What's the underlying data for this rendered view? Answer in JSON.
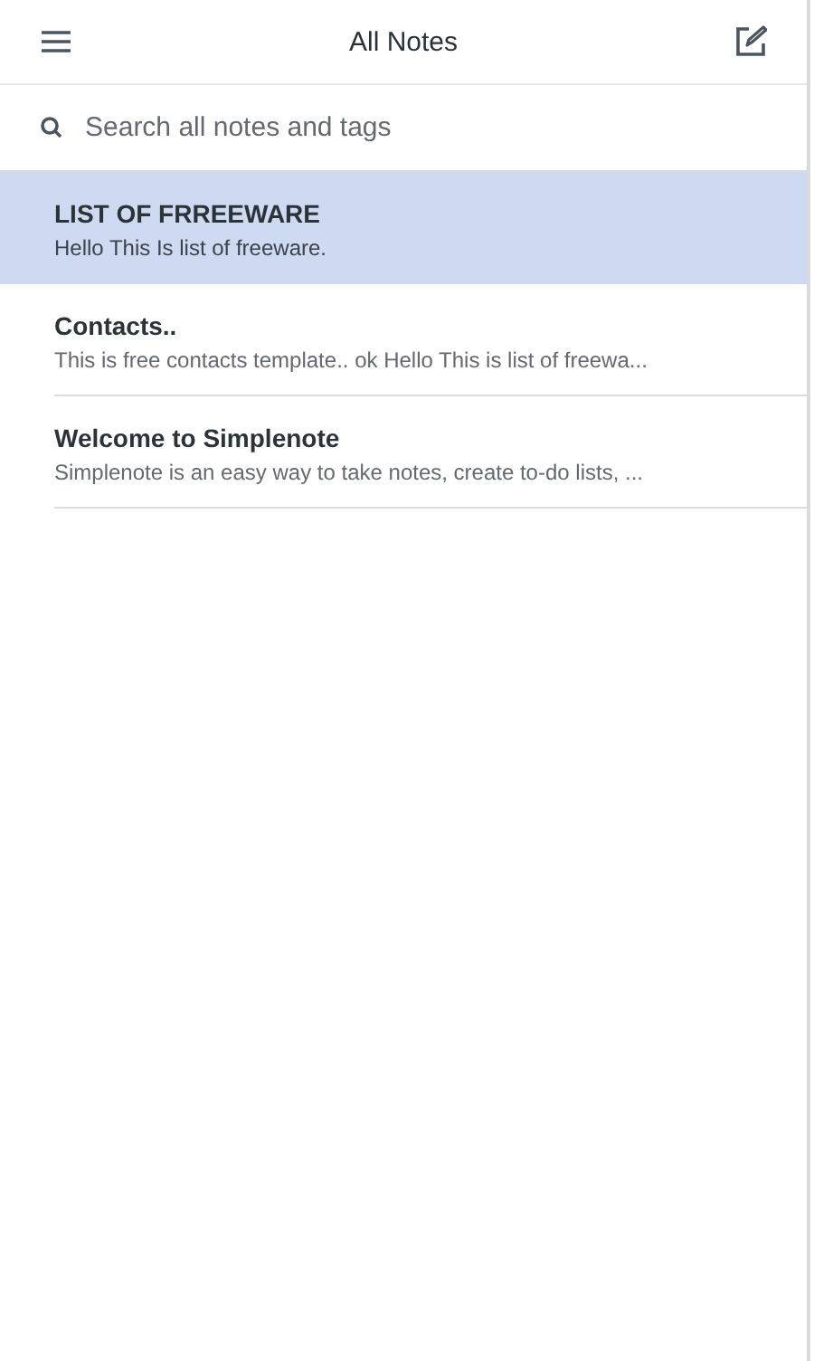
{
  "header": {
    "title": "All Notes"
  },
  "search": {
    "placeholder": "Search all notes and tags"
  },
  "notes": [
    {
      "title": "LIST OF FRREEWARE",
      "preview": "Hello This Is list of freeware.",
      "selected": true
    },
    {
      "title": "Contacts..",
      "preview": "This is free contacts template.. ok Hello This is list of freewa...",
      "selected": false
    },
    {
      "title": "Welcome to Simplenote",
      "preview": "Simplenote is an easy way to take notes, create to-do lists, ...",
      "selected": false
    }
  ]
}
